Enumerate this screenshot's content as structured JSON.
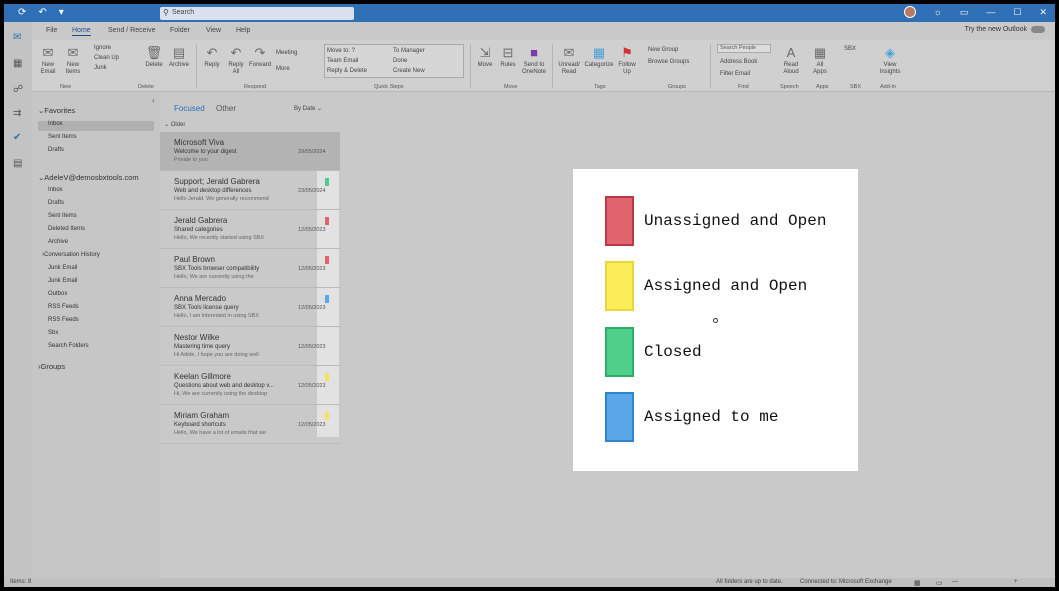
{
  "titlebar": {
    "search_placeholder": "Search",
    "window_controls": [
      "minimize",
      "maximize",
      "close"
    ]
  },
  "menu": {
    "tabs": [
      "File",
      "Home",
      "Send / Receive",
      "Folder",
      "View",
      "Help"
    ],
    "active": "Home",
    "try_new": "Try the new Outlook"
  },
  "ribbon": {
    "new_email": "New Email",
    "new_items": "New Items",
    "ignore": "Ignore",
    "clean_up": "Clean Up",
    "junk": "Junk",
    "delete": "Delete",
    "archive": "Archive",
    "reply": "Reply",
    "reply_all": "Reply All",
    "forward": "Forward",
    "meeting": "Meeting",
    "more": "More",
    "qs_move_to": "Move to: ?",
    "qs_team_email": "Team Email",
    "qs_reply_delete": "Reply & Delete",
    "qs_to_manager": "To Manager",
    "qs_done": "Done",
    "qs_create_new": "Create New",
    "move": "Move",
    "rules": "Rules",
    "send_to_onenote": "Send to OneNote",
    "unread_read": "Unread/ Read",
    "categorize": "Categorize",
    "follow_up": "Follow Up",
    "new_group": "New Group",
    "browse_groups": "Browse Groups",
    "search_people": "Search People",
    "address_book": "Address Book",
    "filter_email": "Filter Email",
    "read_aloud": "Read Aloud",
    "all_apps": "All Apps",
    "sbx": "SBX",
    "view_insights": "View Insights",
    "groups": [
      "New",
      "Delete",
      "Respond",
      "Quick Steps",
      "Move",
      "Tags",
      "Groups",
      "Find",
      "Speech",
      "Apps",
      "SBX",
      "Add-in"
    ]
  },
  "folders": {
    "favorites": "Favorites",
    "fav_items": [
      "Inbox",
      "Sent Items",
      "Drafts"
    ],
    "account": "AdeleV@demosbxtools.com",
    "account_items": [
      "Inbox",
      "Drafts",
      "Sent Items",
      "Deleted Items",
      "Archive",
      "Conversation History",
      "Junk Email",
      "Junk Email",
      "Outbox",
      "RSS Feeds",
      "RSS Feeds",
      "Sbx",
      "Search Folders"
    ],
    "groups": "Groups"
  },
  "messages": {
    "focused": "Focused",
    "other": "Other",
    "sort": "By Date",
    "section": "Older",
    "rows": [
      {
        "from": "Microsoft Viva",
        "subject": "Welcome to your digest",
        "preview": "Private to you",
        "date": "29/05/2024",
        "cat": ""
      },
      {
        "from": "Support; Jerald Gabrera",
        "subject": "Web and desktop differences",
        "preview": "Hello Jerald, We generally recommend",
        "date": "23/05/2024",
        "cat": "#55c98a"
      },
      {
        "from": "Jerald Gabrera",
        "subject": "Shared categories",
        "preview": "Hello, We recently started using SBX",
        "date": "12/05/2023",
        "cat": "#e0646e"
      },
      {
        "from": "Paul Brown",
        "subject": "SBX Tools browser compatibility",
        "preview": "Hello, We are currently using the",
        "date": "12/05/2023",
        "cat": "#e0646e"
      },
      {
        "from": "Anna Mercado",
        "subject": "SBX Tools license query",
        "preview": "Hello, I am interested in using SBX",
        "date": "12/05/2023",
        "cat": "#5aa8e8"
      },
      {
        "from": "Nestor Wilke",
        "subject": "Mastering time query",
        "preview": "Hi Adele, I hope you are doing well",
        "date": "12/05/2023",
        "cat": ""
      },
      {
        "from": "Keelan Gillmore",
        "subject": "Questions about web and desktop v...",
        "preview": "Hi, We are currently using the desktop",
        "date": "12/05/2023",
        "cat": "#f2e35a"
      },
      {
        "from": "Miriam Graham",
        "subject": "Keyboard shortcuts",
        "preview": "Hello, We have a lot of emails that we",
        "date": "12/05/2023",
        "cat": "#f2e35a"
      }
    ]
  },
  "legend": {
    "items": [
      {
        "label": "Unassigned and Open",
        "color": "#e0646e",
        "border": "#b83a46"
      },
      {
        "label": "Assigned and Open",
        "color": "#fbee5a",
        "border": "#e8d63a"
      },
      {
        "label": "Closed",
        "color": "#4ecf8a",
        "border": "#2fae6a"
      },
      {
        "label": "Assigned to me",
        "color": "#5aa8e8",
        "border": "#2f86cf"
      }
    ]
  },
  "status": {
    "items": "Items: 8",
    "folders_up_to_date": "All folders are up to date.",
    "connected": "Connected to: Microsoft Exchange"
  }
}
